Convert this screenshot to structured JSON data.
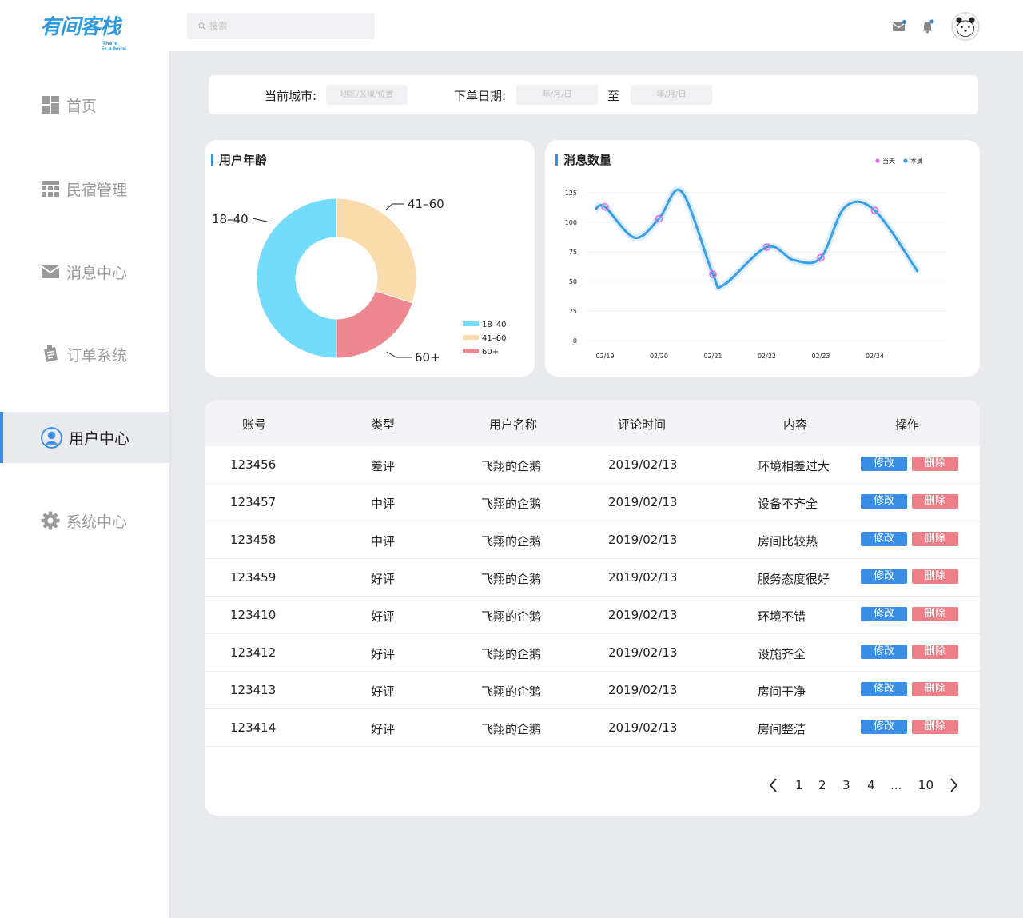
{
  "logo": {
    "main": "有间客栈",
    "sub": "There is a hotel"
  },
  "sidebar": {
    "items": [
      {
        "label": "首页",
        "icon": "dashboard-icon",
        "active": false
      },
      {
        "label": "民宿管理",
        "icon": "grid-icon",
        "active": false
      },
      {
        "label": "消息中心",
        "icon": "mail-icon",
        "active": false
      },
      {
        "label": "订单系统",
        "icon": "order-icon",
        "active": false
      },
      {
        "label": "用户中心",
        "icon": "user-icon",
        "active": true
      },
      {
        "label": "系统中心",
        "icon": "gear-icon",
        "active": false
      }
    ]
  },
  "topbar": {
    "search_placeholder": "搜索",
    "icons": [
      "mail-icon",
      "bell-icon",
      "avatar"
    ]
  },
  "filter": {
    "city_label": "当前城市:",
    "city_placeholder": "地区/区域/位置",
    "date_label": "下单日期:",
    "date_from_placeholder": "年/月/日",
    "to_label": "至",
    "date_to_placeholder": "年/月/日"
  },
  "age_chart": {
    "title": "用户年龄",
    "chart_data": {
      "type": "pie",
      "categories": [
        "18-40",
        "41-60",
        "60+"
      ],
      "values": [
        50,
        30,
        20
      ],
      "colors": [
        "#72dcfa",
        "#f9dbac",
        "#ef8790"
      ],
      "labels": [
        "18–40",
        "41–60",
        "60+"
      ],
      "legend": [
        "18–40",
        "41–60",
        "60+"
      ],
      "legend_position": "bottom-right"
    }
  },
  "msg_chart": {
    "title": "消息数量",
    "chart_data": {
      "type": "line",
      "x": [
        "02/19",
        "02/20",
        "02/21",
        "02/22",
        "02/23",
        "02/24"
      ],
      "yticks": [
        "0",
        "25",
        "50",
        "75",
        "100",
        "125"
      ],
      "ylim": [
        0,
        125
      ],
      "series": [
        {
          "name": "当天",
          "color": "#dd6fe0",
          "points": [
            [
              0,
              113
            ],
            [
              1,
              103
            ],
            [
              2,
              56
            ],
            [
              3,
              79
            ],
            [
              4,
              70
            ],
            [
              5,
              110
            ]
          ]
        },
        {
          "name": "本周",
          "color": "#3a9ee6",
          "curve": [
            [
              -0.18,
              111
            ],
            [
              0,
              113
            ],
            [
              0.55,
              87
            ],
            [
              1,
              103
            ],
            [
              1.42,
              126
            ],
            [
              2,
              56
            ],
            [
              2.2,
              47
            ],
            [
              3,
              79
            ],
            [
              3.5,
              68
            ],
            [
              4,
              70
            ],
            [
              4.45,
              113
            ],
            [
              5,
              110
            ],
            [
              5.8,
              58
            ]
          ]
        }
      ],
      "legend": [
        "当天",
        "本周"
      ],
      "legend_position": "top-right",
      "grid": true
    }
  },
  "table": {
    "headers": [
      "账号",
      "类型",
      "用户名称",
      "评论时间",
      "内容",
      "操作"
    ],
    "rows": [
      {
        "account": "123456",
        "type": "差评",
        "user": "飞翔的企鹅",
        "time": "2019/02/13",
        "content": "环境相差过大"
      },
      {
        "account": "123457",
        "type": "中评",
        "user": "飞翔的企鹅",
        "time": "2019/02/13",
        "content": "设备不齐全"
      },
      {
        "account": "123458",
        "type": "中评",
        "user": "飞翔的企鹅",
        "time": "2019/02/13",
        "content": "房间比较热"
      },
      {
        "account": "123459",
        "type": "好评",
        "user": "飞翔的企鹅",
        "time": "2019/02/13",
        "content": "服务态度很好"
      },
      {
        "account": "123410",
        "type": "好评",
        "user": "飞翔的企鹅",
        "time": "2019/02/13",
        "content": "环境不错"
      },
      {
        "account": "123412",
        "type": "好评",
        "user": "飞翔的企鹅",
        "time": "2019/02/13",
        "content": "设施齐全"
      },
      {
        "account": "123413",
        "type": "好评",
        "user": "飞翔的企鹅",
        "time": "2019/02/13",
        "content": "房间干净"
      },
      {
        "account": "123414",
        "type": "好评",
        "user": "飞翔的企鹅",
        "time": "2019/02/13",
        "content": "房间整洁"
      }
    ],
    "edit_label": "修改",
    "delete_label": "删除"
  },
  "pagination": {
    "pages": [
      "1",
      "2",
      "3",
      "4",
      "...",
      "10"
    ],
    "prev": "‹",
    "next": "›"
  }
}
